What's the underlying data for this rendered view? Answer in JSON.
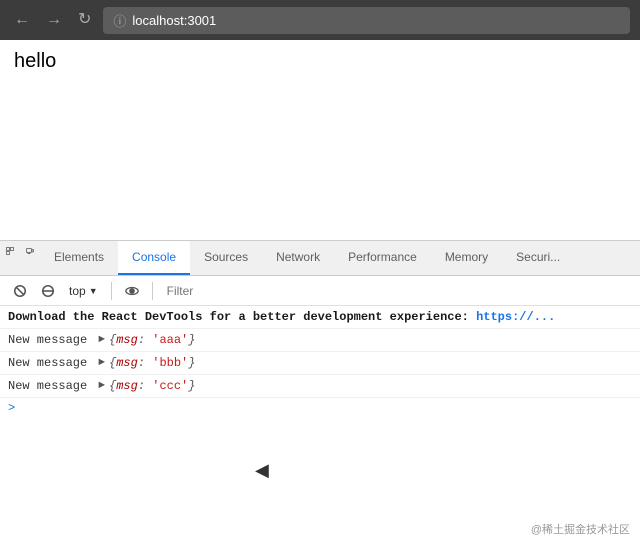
{
  "browser": {
    "back_label": "←",
    "forward_label": "→",
    "reload_label": "↺",
    "url": "localhost:3001"
  },
  "page": {
    "content": "hello"
  },
  "devtools": {
    "tabs": [
      {
        "id": "elements",
        "label": "Elements",
        "active": false
      },
      {
        "id": "console",
        "label": "Console",
        "active": true
      },
      {
        "id": "sources",
        "label": "Sources",
        "active": false
      },
      {
        "id": "network",
        "label": "Network",
        "active": false
      },
      {
        "id": "performance",
        "label": "Performance",
        "active": false
      },
      {
        "id": "memory",
        "label": "Memory",
        "active": false
      },
      {
        "id": "security",
        "label": "Securi...",
        "active": false
      }
    ],
    "toolbar": {
      "context": "top",
      "filter_placeholder": "Filter"
    },
    "console_lines": [
      {
        "type": "info",
        "text": "Download the React DevTools for a better development experience: ",
        "link": "https://..."
      },
      {
        "type": "log",
        "prefix": "New message",
        "object": "{msg: 'aaa'}"
      },
      {
        "type": "log",
        "prefix": "New message",
        "object": "{msg: 'bbb'}"
      },
      {
        "type": "log",
        "prefix": "New message",
        "object": "{msg: 'ccc'}"
      }
    ],
    "prompt": ">"
  },
  "watermark": "@稀土掘金技术社区"
}
